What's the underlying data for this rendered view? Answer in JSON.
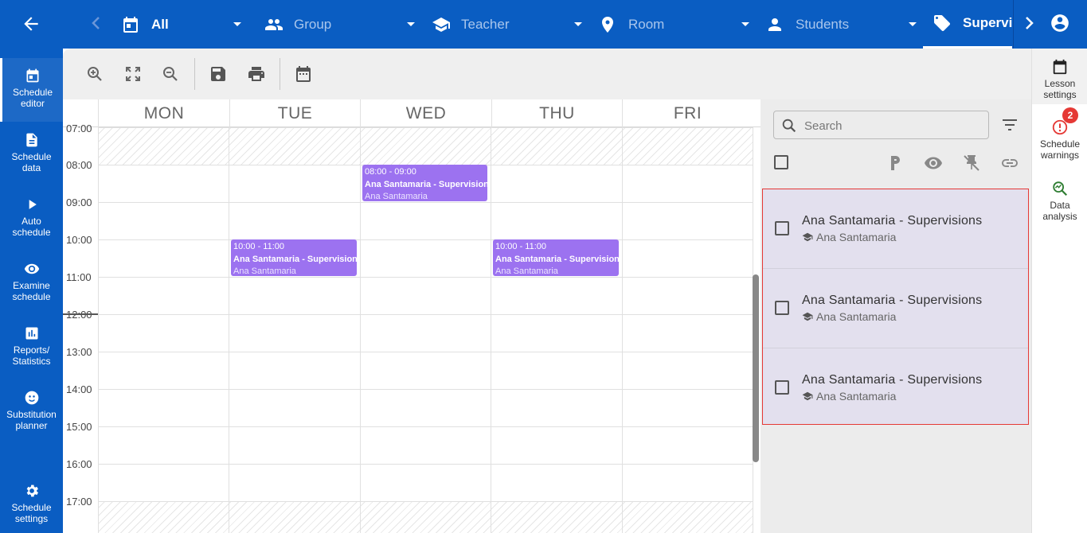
{
  "topbar": {
    "tabs": [
      {
        "label": "All",
        "icon": "calendar-icon"
      },
      {
        "label": "Group",
        "icon": "group-icon"
      },
      {
        "label": "Teacher",
        "icon": "school-icon"
      },
      {
        "label": "Room",
        "icon": "location-pin-icon"
      },
      {
        "label": "Students",
        "icon": "person-icon"
      },
      {
        "label": "Supervis",
        "icon": "tag-icon"
      }
    ]
  },
  "sidebar": {
    "items": [
      {
        "label": "Schedule\neditor",
        "icon": "calendar-today-icon"
      },
      {
        "label": "Schedule\ndata",
        "icon": "document-icon"
      },
      {
        "label": "Auto\nschedule",
        "icon": "play-icon"
      },
      {
        "label": "Examine\nschedule",
        "icon": "eye-icon"
      },
      {
        "label": "Reports/\nStatistics",
        "icon": "bar-chart-icon"
      },
      {
        "label": "Substitution\nplanner",
        "icon": "face-swap-icon"
      },
      {
        "label": "Schedule\nsettings",
        "icon": "gear-icon"
      }
    ]
  },
  "calendar": {
    "days": [
      "MON",
      "TUE",
      "WED",
      "THU",
      "FRI"
    ],
    "hours": [
      "07:00",
      "08:00",
      "09:00",
      "10:00",
      "11:00",
      "12:00",
      "13:00",
      "14:00",
      "15:00",
      "16:00",
      "17:00"
    ],
    "events": [
      {
        "time": "08:00 - 09:00",
        "name": "Ana Santamaria - Supervisions",
        "teacher": "Ana Santamaria"
      },
      {
        "time": "10:00 - 11:00",
        "name": "Ana Santamaria - Supervisions",
        "teacher": "Ana Santamaria"
      },
      {
        "time": "10:00 - 11:00",
        "name": "Ana Santamaria - Supervisions",
        "teacher": "Ana Santamaria"
      }
    ]
  },
  "lesson_panel": {
    "search_placeholder": "Search",
    "lessons": [
      {
        "title": "Ana Santamaria - Supervisions",
        "teacher": "Ana Santamaria"
      },
      {
        "title": "Ana Santamaria - Supervisions",
        "teacher": "Ana Santamaria"
      },
      {
        "title": "Ana Santamaria - Supervisions",
        "teacher": "Ana Santamaria"
      }
    ]
  },
  "right_rail": {
    "items": [
      {
        "label": "Lesson\nsettings",
        "icon": "calendar-icon"
      },
      {
        "label": "Schedule\nwarnings",
        "icon": "warning-icon",
        "badge": "2"
      },
      {
        "label": "Data\nanalysis",
        "icon": "analytics-icon"
      }
    ]
  },
  "colors": {
    "brand": "#0a5dc2",
    "event": "#9c72f0",
    "selection_border": "#e53935",
    "badge": "#e53935"
  }
}
